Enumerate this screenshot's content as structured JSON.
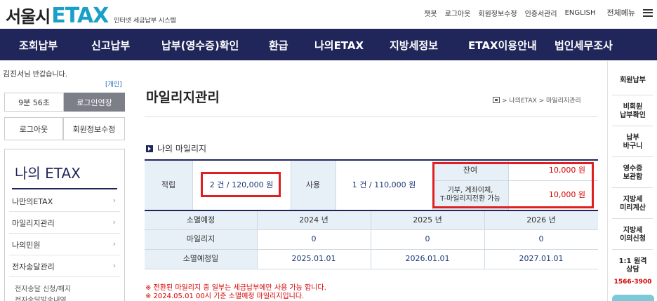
{
  "header": {
    "logo_seoul": "서울시",
    "logo_etax": "ETAX",
    "logo_sub": "인터넷 세금납부 시스템",
    "util_links": [
      "챗봇",
      "로그아웃",
      "회원정보수정",
      "인증서관리",
      "ENGLISH"
    ],
    "menu_all": "전체메뉴"
  },
  "nav": [
    "조회납부",
    "신고납부",
    "납부(영수증)확인",
    "환급",
    "나의ETAX",
    "지방세정보",
    "ETAX이용안내",
    "법인세무조사"
  ],
  "sidebar": {
    "greeting_name": "김진서",
    "greeting_suffix": "님 반갑습니다.",
    "account_type": "[개인]",
    "timer": "9분 56초",
    "extend_login": "로그인연장",
    "logout": "로그아웃",
    "edit_member": "회원정보수정",
    "section_title": "나의 ETAX",
    "items": [
      "나만의ETAX",
      "마일리지관리",
      "나의민원",
      "전자송달관리"
    ],
    "subitems": [
      "전자송달 신청/해지",
      "전자송달발송내역"
    ]
  },
  "main": {
    "title": "마일리지관리",
    "breadcrumb": "> 나의ETAX > 마일리지관리",
    "section": "나의 마일리지",
    "table": {
      "accrued_label": "적립",
      "accrued_value": "2 건 / 120,000 원",
      "used_label": "사용",
      "used_value": "1 건 / 110,000 원",
      "balance_label": "잔여",
      "balance_value": "10,000 원",
      "donation_label": "기부, 계좌이체,\nT-마일리지전환 가능",
      "donation_value": "10,000 원",
      "expire_label": "소멸예정",
      "years": [
        "2024 년",
        "2025 년",
        "2026 년"
      ],
      "mileage_label": "마일리지",
      "mileage_values": [
        "0",
        "0",
        "0"
      ],
      "expire_date_label": "소멸예정일",
      "expire_dates": [
        "2025.01.01",
        "2026.01.01",
        "2027.01.01"
      ]
    },
    "notes": [
      "※ 전환된 마일리지 중 일부는 세금납부에만 사용 가능 합니다.",
      "※ 2024.05.01 00시 기준 소멸예정 마일리지입니다."
    ]
  },
  "quick_menu": {
    "items": [
      "회원납부",
      "비회원\n납부확인",
      "납부\n바구니",
      "영수증\n보관함",
      "지방세\n미리계산",
      "지방세\n이의신청",
      "1:1 원격\n상담"
    ],
    "phone": "1566-3900"
  },
  "colors": {
    "nav_bg": "#20265a",
    "accent": "#1aa0c8",
    "highlight": "#e02020",
    "header_cell": "#e7f0f7"
  }
}
